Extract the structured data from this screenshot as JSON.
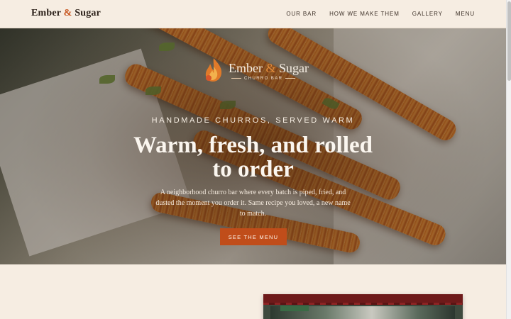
{
  "header": {
    "brand_name": "Ember",
    "brand_amp": "&",
    "brand_name_2": "Sugar",
    "nav": [
      {
        "label": "Our Bar"
      },
      {
        "label": "How We Make Them"
      },
      {
        "label": "Gallery"
      },
      {
        "label": "Menu"
      }
    ]
  },
  "hero": {
    "logo": {
      "name_1": "Ember",
      "amp": "&",
      "name_2": "Sugar",
      "subtitle": "CHURRO BAR"
    },
    "eyebrow": "Handmade churros, served warm",
    "headline": "Warm, fresh, and rolled to order",
    "lede": "A neighborhood churro bar where every batch is piped, fried, and dusted the moment you order it. Same recipe you loved, a new name to match.",
    "cta_label": "See the Menu"
  },
  "colors": {
    "accent": "#c04d1a",
    "background": "#f6ede2",
    "text": "#2b2019"
  },
  "icons": {
    "logo": "flame-churro-icon"
  }
}
